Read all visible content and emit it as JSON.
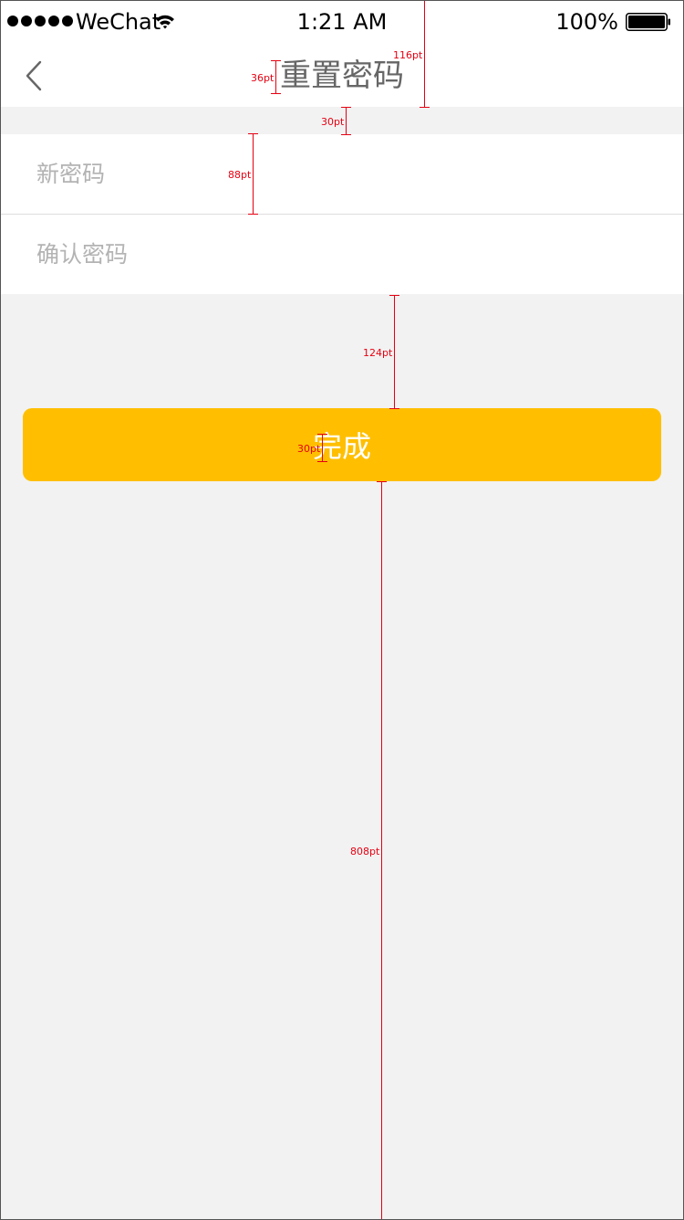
{
  "status_bar": {
    "carrier": "WeChat",
    "time": "1:21 AM",
    "battery": "100%",
    "icons": [
      "signal-dots-icon",
      "wifi-icon",
      "battery-icon"
    ]
  },
  "nav": {
    "title": "重置密码",
    "back_icon": "chevron-left-icon"
  },
  "form": {
    "new_password_placeholder": "新密码",
    "confirm_password_placeholder": "确认密码",
    "new_password_value": "",
    "confirm_password_value": ""
  },
  "button": {
    "done_label": "完成"
  },
  "colors": {
    "accent": "#ffbf00",
    "background": "#f2f2f2",
    "annotation": "#e60012"
  },
  "annotations": {
    "nav_height": "116pt",
    "title_font": "36pt",
    "gap": "30pt",
    "row_height": "88pt",
    "button_gap": "124pt",
    "button_font": "30pt",
    "bottom_space": "808pt"
  }
}
